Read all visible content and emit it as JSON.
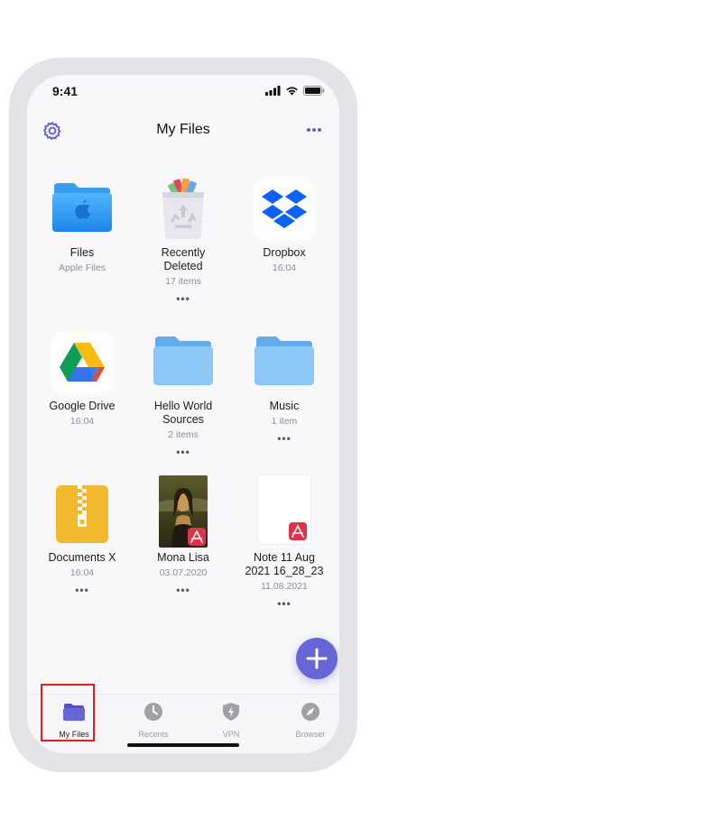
{
  "status_bar": {
    "time": "9:41"
  },
  "header": {
    "title": "My Files"
  },
  "items": [
    {
      "name": "Files",
      "meta": "Apple Files",
      "icon": "apple-files-folder-icon"
    },
    {
      "name": "Recently\nDeleted",
      "meta": "17 items",
      "icon": "trash-icon"
    },
    {
      "name": "Dropbox",
      "meta": "16:04",
      "icon": "dropbox-icon"
    },
    {
      "name": "Google Drive",
      "meta": "16:04",
      "icon": "google-drive-icon"
    },
    {
      "name": "Hello World\nSources",
      "meta": "2 items",
      "icon": "folder-icon"
    },
    {
      "name": "Music",
      "meta": "1 item",
      "icon": "folder-icon"
    },
    {
      "name": "Documents X",
      "meta": "16:04",
      "icon": "zip-archive-icon"
    },
    {
      "name": "Mona Lisa",
      "meta": "03.07.2020",
      "icon": "image-pdf-icon"
    },
    {
      "name": "Note 11 Aug\n2021 16_28_23",
      "meta": "11.08.2021",
      "icon": "pdf-document-icon"
    }
  ],
  "more_label": "•••",
  "tabs": [
    {
      "label": "My Files",
      "icon": "folder-icon",
      "active": true
    },
    {
      "label": "Recents",
      "icon": "clock-icon",
      "active": false
    },
    {
      "label": "VPN",
      "icon": "shield-icon",
      "active": false
    },
    {
      "label": "Browser",
      "icon": "compass-icon",
      "active": false
    }
  ],
  "colors": {
    "accent": "#6766d6",
    "folder": "#6fb3f2",
    "zip": "#f2b82e",
    "pdf": "#e0334b",
    "highlight": "#e01e1e"
  }
}
